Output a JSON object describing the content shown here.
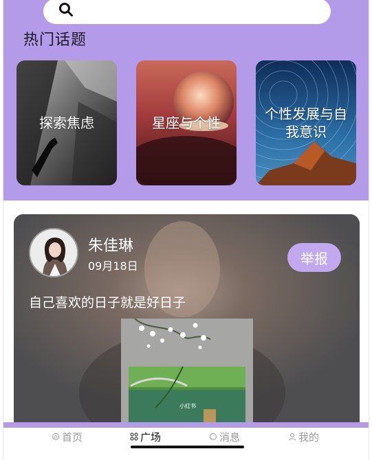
{
  "search": {
    "icon": "search-icon"
  },
  "hot_topics": {
    "title": "热门话题",
    "items": [
      {
        "label": "探索焦虑",
        "image": "hand-shadow-photo"
      },
      {
        "label": "星座与个性",
        "image": "crystal-ball-photo"
      },
      {
        "label": "个性发展与自我意识",
        "image": "star-trails-mountain-photo"
      }
    ]
  },
  "post": {
    "author": "朱佳琳",
    "date": "09月18日",
    "report_label": "举报",
    "text": "自己喜欢的日子就是好日子",
    "image": "lake-flowers-illustration",
    "image_caption": "小红书"
  },
  "tabbar": {
    "items": [
      {
        "label": "首页",
        "icon": "home-icon",
        "active": false
      },
      {
        "label": "广场",
        "icon": "grid-icon",
        "active": true
      },
      {
        "label": "消息",
        "icon": "message-icon",
        "active": false
      },
      {
        "label": "我的",
        "icon": "user-icon",
        "active": false
      }
    ]
  },
  "colors": {
    "accent": "#b49be9",
    "report_button": "#c2a8ef",
    "card_bg": "#5a5a5c"
  }
}
